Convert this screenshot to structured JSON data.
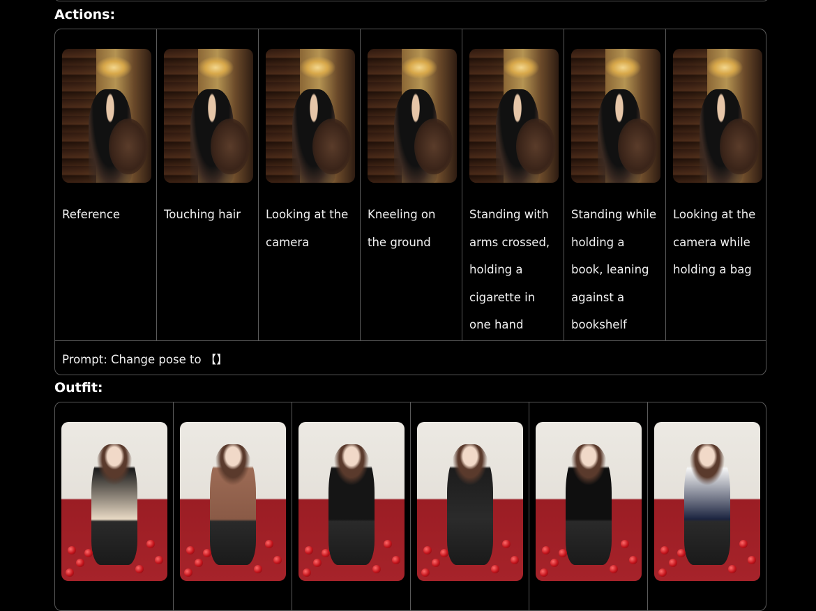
{
  "actions": {
    "title": "Actions:",
    "items": [
      {
        "label": "Reference"
      },
      {
        "label": "Touching hair"
      },
      {
        "label": "Looking at the camera"
      },
      {
        "label": "Kneeling on the ground"
      },
      {
        "label": "Standing with arms crossed, holding a cigarette in one hand"
      },
      {
        "label": "Standing while holding a book, leaning against a bookshelf"
      },
      {
        "label": "Looking at the camera while holding a bag"
      }
    ],
    "prompt": "Prompt: Change pose to 【】"
  },
  "outfit": {
    "title": "Outfit:",
    "items": [
      {
        "dress_color": "#1a1a1a",
        "accent": "#e8d9c4"
      },
      {
        "dress_color": "#9c6b55",
        "accent": "#8a5a46"
      },
      {
        "dress_color": "#151515",
        "accent": "#151515"
      },
      {
        "dress_color": "#1c1c1c",
        "accent": "#2b2b2b"
      },
      {
        "dress_color": "#0f0f0f",
        "accent": "#0f0f0f"
      },
      {
        "dress_color": "#f4f4f4",
        "accent": "#1c2440"
      }
    ]
  }
}
